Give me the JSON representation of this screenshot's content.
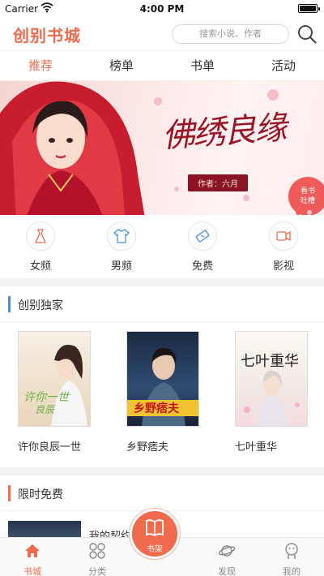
{
  "status_bar": {
    "carrier": "Carrier",
    "time": "4:00 PM"
  },
  "header": {
    "logo": "创别书城",
    "search_placeholder": "搜索小说、作者"
  },
  "tabs": [
    {
      "label": "推荐",
      "active": true
    },
    {
      "label": "榜单"
    },
    {
      "label": "书单"
    },
    {
      "label": "活动"
    }
  ],
  "banner": {
    "title": "佛绣良缘",
    "author": "作者：六月",
    "badge": "看书\n吐槽"
  },
  "categories": [
    {
      "label": "女频",
      "icon": "dress-icon"
    },
    {
      "label": "男频",
      "icon": "shirt-icon"
    },
    {
      "label": "免费",
      "icon": "ticket-icon"
    },
    {
      "label": "影视",
      "icon": "video-icon"
    }
  ],
  "exclusive": {
    "title": "创别独家",
    "accent": "#4a90d9",
    "books": [
      {
        "name": "许你良辰一世"
      },
      {
        "name": "乡野痞夫"
      },
      {
        "name": "七叶重华"
      }
    ]
  },
  "free": {
    "title": "限时免费",
    "accent": "#f06a4d",
    "first_book": "我的契约"
  },
  "bottom_nav": [
    {
      "label": "书城",
      "icon": "home-icon",
      "active": true
    },
    {
      "label": "分类",
      "icon": "grid-icon"
    },
    {
      "label": "书架",
      "icon": "book-icon"
    },
    {
      "label": "发现",
      "icon": "planet-icon"
    },
    {
      "label": "我的",
      "icon": "profile-icon"
    }
  ],
  "colors": {
    "brand": "#f06a4d"
  }
}
